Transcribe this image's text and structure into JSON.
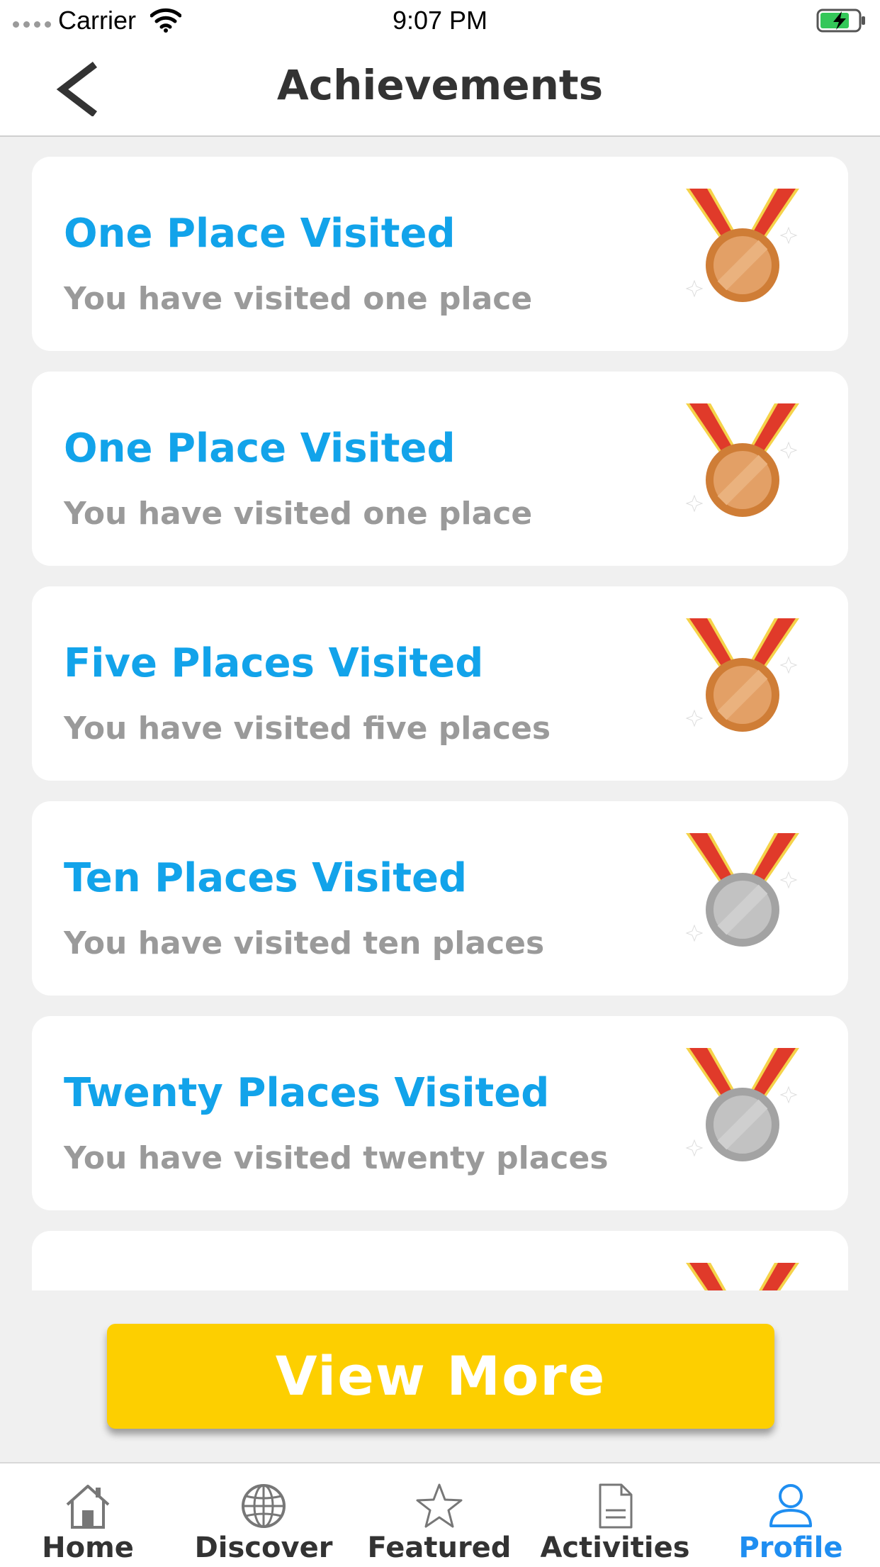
{
  "status_bar": {
    "carrier": "Carrier",
    "time": "9:07 PM"
  },
  "header": {
    "title": "Achievements"
  },
  "achievements": [
    {
      "title": "One Place Visited",
      "subtitle": "You have visited one place",
      "medal": "bronze-medal-icon"
    },
    {
      "title": "One Place Visited",
      "subtitle": "You have visited one place",
      "medal": "bronze-medal-icon"
    },
    {
      "title": "Five Places Visited",
      "subtitle": "You have visited five places",
      "medal": "bronze-medal-icon"
    },
    {
      "title": "Ten Places Visited",
      "subtitle": "You have visited ten places",
      "medal": "silver-medal-icon"
    },
    {
      "title": "Twenty Places Visited",
      "subtitle": "You have visited twenty places",
      "medal": "silver-medal-icon"
    },
    {
      "title": "",
      "subtitle": "",
      "medal": "medal-icon"
    }
  ],
  "view_more_label": "View More",
  "tabs": [
    {
      "label": "Home",
      "icon": "home-icon"
    },
    {
      "label": "Discover",
      "icon": "globe-icon"
    },
    {
      "label": "Featured",
      "icon": "star-icon"
    },
    {
      "label": "Activities",
      "icon": "document-icon"
    },
    {
      "label": "Profile",
      "icon": "person-icon",
      "active": true
    }
  ],
  "colors": {
    "accent_blue": "#12a3ea",
    "button_yellow": "#fdcf00",
    "active_tab": "#1f8ef1",
    "bronze": "#d98b45",
    "silver": "#a9a9a9",
    "ribbon_red": "#e03a2a",
    "ribbon_gold": "#f5d34a"
  }
}
